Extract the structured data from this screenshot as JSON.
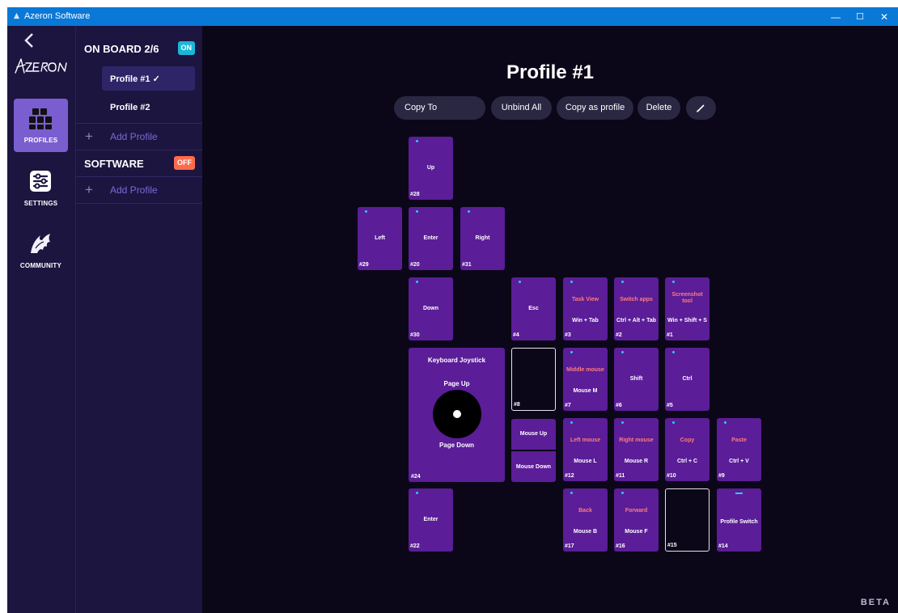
{
  "window": {
    "title": "Azeron Software",
    "minimize": "—",
    "maximize": "☐",
    "close": "✕"
  },
  "rail": {
    "items": [
      {
        "id": "profiles",
        "label": "PROFILES",
        "icon": "grid-icon",
        "active": true
      },
      {
        "id": "settings",
        "label": "SETTINGS",
        "icon": "sliders-icon",
        "active": false
      },
      {
        "id": "community",
        "label": "COMMUNITY",
        "icon": "dragon-icon",
        "active": false
      }
    ]
  },
  "panel": {
    "onboard": {
      "title": "ON BOARD 2/6",
      "badge": "ON"
    },
    "profiles": [
      {
        "label": "Profile #1 ✓",
        "selected": true
      },
      {
        "label": "Profile #2",
        "selected": false
      }
    ],
    "add_profile": "Add Profile",
    "software": {
      "title": "SOFTWARE",
      "badge": "OFF"
    },
    "add_profile_software": "Add Profile"
  },
  "main": {
    "title": "Profile #1",
    "toolbar": {
      "copy_to": "Copy To",
      "unbind_all": "Unbind All",
      "copy_as_profile": "Copy as profile",
      "delete": "Delete",
      "edit_icon": "pencil-icon"
    },
    "keys": [
      {
        "id": "k28",
        "caption": "",
        "bind": "Up",
        "num": "#28"
      },
      {
        "id": "k29",
        "caption": "",
        "bind": "Left",
        "num": "#29"
      },
      {
        "id": "k20",
        "caption": "",
        "bind": "Enter",
        "num": "#20"
      },
      {
        "id": "k31",
        "caption": "",
        "bind": "Right",
        "num": "#31"
      },
      {
        "id": "k30",
        "caption": "",
        "bind": "Down",
        "num": "#30"
      },
      {
        "id": "k4",
        "caption": "",
        "bind": "Esc",
        "num": "#4"
      },
      {
        "id": "k3",
        "caption": "Task View",
        "bind": "Win + Tab",
        "num": "#3"
      },
      {
        "id": "k2",
        "caption": "Switch apps",
        "bind": "Ctrl + Alt + Tab",
        "num": "#2"
      },
      {
        "id": "k1",
        "caption": "Screenshot tool",
        "bind": "Win + Shift + S",
        "num": "#1"
      },
      {
        "id": "k8",
        "caption": "",
        "bind": "",
        "num": "#8"
      },
      {
        "id": "k7",
        "caption": "Middle mouse",
        "bind": "Mouse M",
        "num": "#7"
      },
      {
        "id": "k6",
        "caption": "",
        "bind": "Shift",
        "num": "#6"
      },
      {
        "id": "k5",
        "caption": "",
        "bind": "Ctrl",
        "num": "#5"
      },
      {
        "id": "k12",
        "caption": "Left mouse",
        "bind": "Mouse L",
        "num": "#12"
      },
      {
        "id": "k11",
        "caption": "Right mouse",
        "bind": "Mouse R",
        "num": "#11"
      },
      {
        "id": "k10",
        "caption": "Copy",
        "bind": "Ctrl + C",
        "num": "#10"
      },
      {
        "id": "k9",
        "caption": "Paste",
        "bind": "Ctrl + V",
        "num": "#9"
      },
      {
        "id": "k22",
        "caption": "",
        "bind": "Enter",
        "num": "#22"
      },
      {
        "id": "k17",
        "caption": "Back",
        "bind": "Mouse B",
        "num": "#17"
      },
      {
        "id": "k16",
        "caption": "Forward",
        "bind": "Mouse F",
        "num": "#16"
      },
      {
        "id": "k15",
        "caption": "",
        "bind": "",
        "num": "#15"
      },
      {
        "id": "k14",
        "caption": "",
        "bind": "Profile Switch",
        "num": "#14"
      }
    ],
    "joystick": {
      "title": "Keyboard Joystick",
      "up": "Page Up",
      "down": "Page Down",
      "num": "#24"
    },
    "wheel": {
      "up": "Mouse Up",
      "down": "Mouse Down"
    },
    "beta": "BETA"
  },
  "colors": {
    "key": "#5b1d98",
    "accent": "#7a5ed0",
    "caption": "#ff7d7d",
    "on": "#1ab6d6",
    "off": "#ff6a4d",
    "titlebar": "#0a78d7"
  }
}
